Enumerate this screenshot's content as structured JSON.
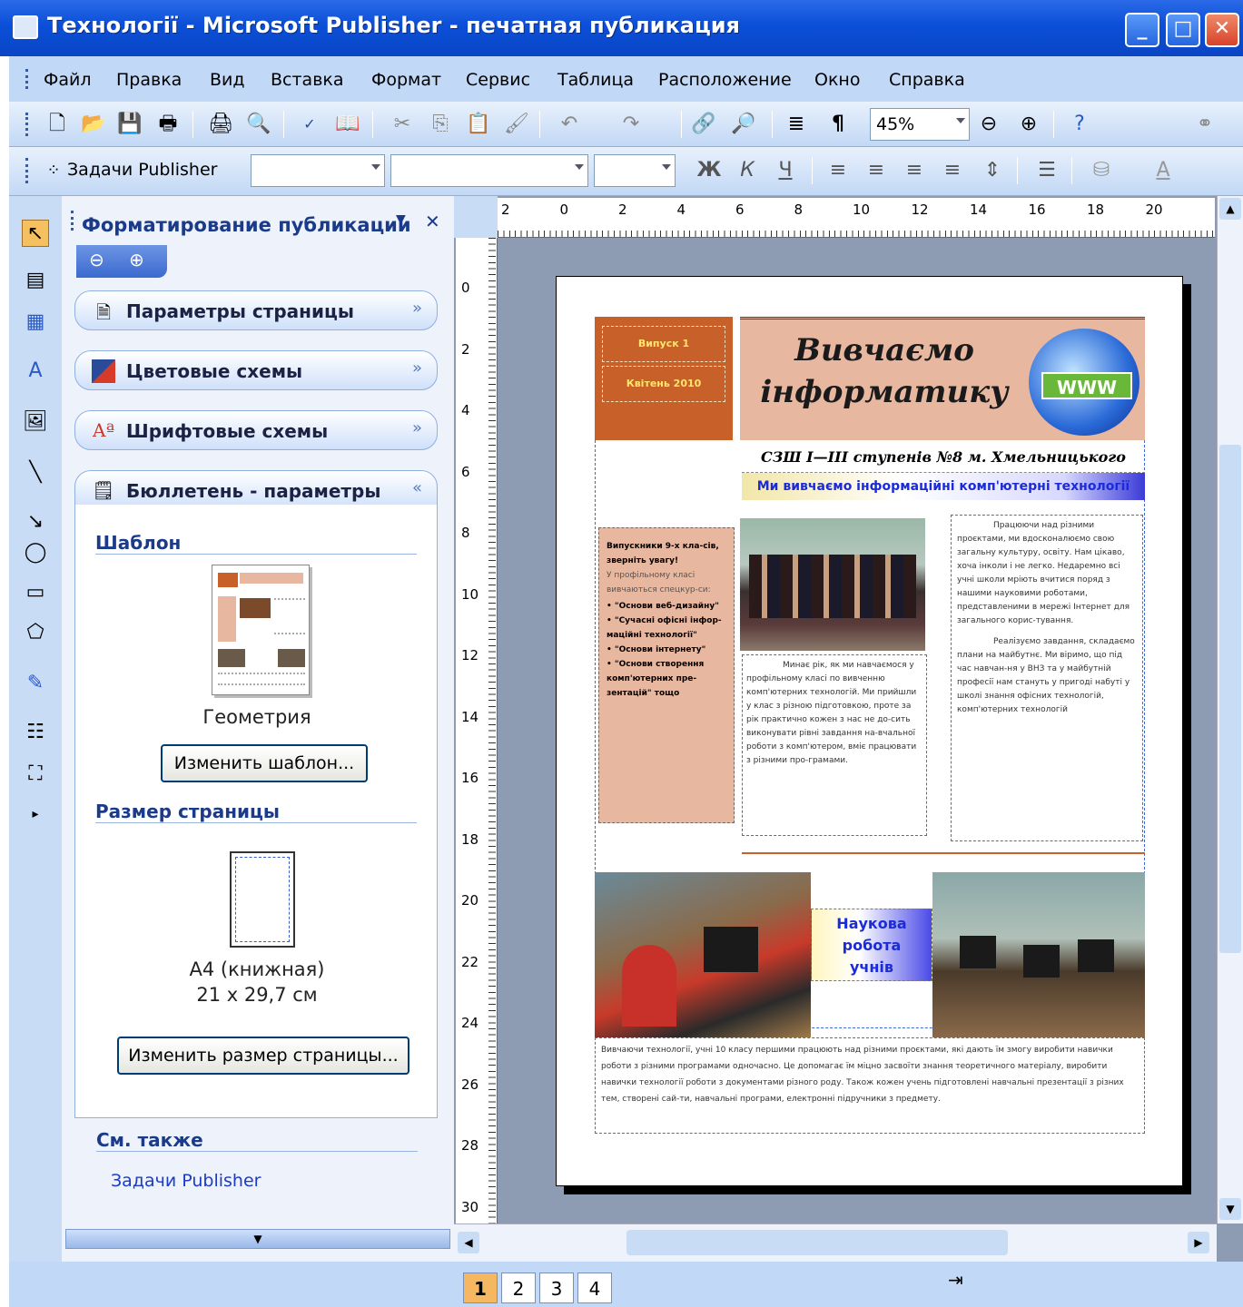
{
  "window": {
    "title": "Технології - Microsoft Publisher - печатная публикация"
  },
  "menu": [
    "Файл",
    "Правка",
    "Вид",
    "Вставка",
    "Формат",
    "Сервис",
    "Таблица",
    "Расположение",
    "Окно",
    "Справка"
  ],
  "toolbar": {
    "zoom": "45%"
  },
  "formatting": {
    "task_label": "Задачи Publisher",
    "bold": "Ж",
    "italic": "К",
    "underline": "Ч"
  },
  "taskpane": {
    "title": "Форматирование публикации",
    "sections": [
      "Параметры страницы",
      "Цветовые схемы",
      "Шрифтовые схемы",
      "Бюллетень - параметры"
    ],
    "template_header": "Шаблон",
    "template_name": "Геометрия",
    "change_template": "Изменить шаблон...",
    "size_header": "Размер страницы",
    "size_name": "А4 (книжная)",
    "size_dims": "21 x 29,7 см",
    "change_size": "Изменить размер страницы...",
    "see_also": "См. также",
    "link": "Задачи Publisher"
  },
  "ruler": {
    "horizontal": [
      "2",
      "0",
      "2",
      "4",
      "6",
      "8",
      "10",
      "12",
      "14",
      "16",
      "18",
      "20"
    ],
    "vertical": [
      "0",
      "2",
      "4",
      "6",
      "8",
      "10",
      "12",
      "14",
      "16",
      "18",
      "20",
      "22",
      "24",
      "26",
      "28",
      "30"
    ]
  },
  "newsletter": {
    "issue": "Випуск 1",
    "date": "Квітень 2010",
    "title_line1": "Вивчаємо",
    "title_line2": "інформатику",
    "www": "WWW",
    "school": "СЗШ I—III ступенів №8 м. Хмельницького",
    "tagline": "Ми вивчаємо інформаційні комп'ютерні технології",
    "sidebar_intro_bold": "Випускники 9-х кла-сів, зверніть увагу!",
    "sidebar_intro": "У профільному класі вивчаються спецкур-си:",
    "sidebar_items": [
      "\"Основи веб-дизайну\"",
      "\"Сучасні офісні інфор-маційні технології\"",
      "\"Основи інтернету\"",
      "\"Основи створення комп'ютерних пре-зентацій\" тощо"
    ],
    "col_middle": "Минає рік, як ми навчаємося у профільному класі по вивченню комп'ютерних технологій. Ми прийшли у клас з різною підготовкою, проте за рік практично кожен з нас не до-сить виконувати рівні завдання на-вчальної роботи з комп'ютером, вміє працювати з різними про-грамами.",
    "col_right_1": "Працюючи над різними проєктами, ми вдосконалюємо свою загальну культуру, освіту. Нам цікаво, хоча інколи і не легко. Недаремно всі учні школи мріють вчитися поряд з нашими науковими роботами, представленими в мережі Інтернет для загального корис-тування.",
    "col_right_2": "Реалізуємо завдання, складаємо плани на майбутнє. Ми віримо, що під час навчан-ня у ВНЗ та у майбутній професії нам стануть у пригоді набуті у школі знання офісних технологій, комп'ютерних технологій",
    "research_label": "Наукова робота учнів",
    "bottom_text": "Вивчаючи технології, учні 10 класу першими працюють над різними проєктами, які дають їм змогу виробити навички роботи з різними програмами одночасно. Це допомагає їм міцно засвоїти знання теоретичного матеріалу, виробити навички технології роботи з документами різного роду. Також кожен учень підготовлені навчальні презентації з різних тем, створені сай-ти, навчальні програми, електронні підручники з предмету."
  },
  "status": {
    "pages": [
      "1",
      "2",
      "3",
      "4"
    ],
    "current_page": "1"
  },
  "colors": {
    "titlebar": "#0b4fd8",
    "menubar": "#c1d8f6",
    "workspace": "#8d9bb3",
    "accent_orange": "#c8602a",
    "peach": "#e8b7a0"
  }
}
